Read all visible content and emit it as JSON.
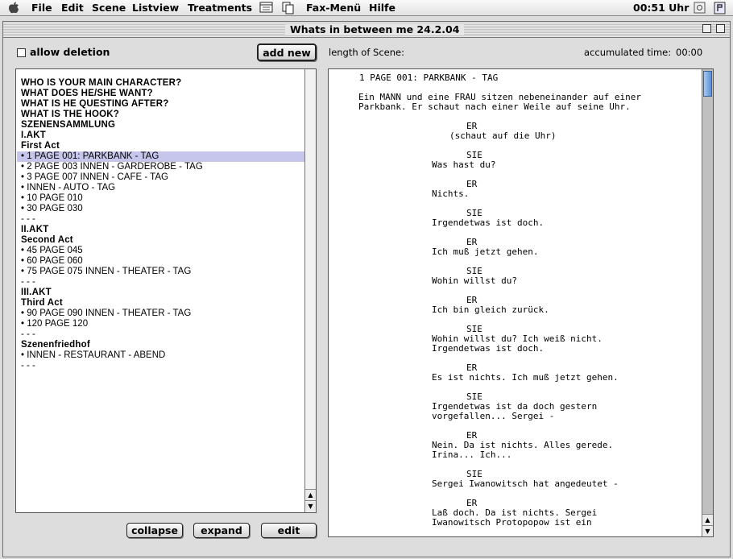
{
  "menubar": {
    "items": [
      "File",
      "Edit",
      "Scene",
      "Listview",
      "Treatments",
      "Fax-Menü",
      "Hilfe"
    ],
    "clock": "00:51 Uhr"
  },
  "window": {
    "title": "Whats in between me 24.2.04"
  },
  "controls": {
    "allow_deletion": "allow deletion",
    "add_new": "add new",
    "length_label": "length of Scene:",
    "accumulated_label": "accumulated time:",
    "accumulated_value": "00:00",
    "collapse": "collapse",
    "expand": "expand",
    "edit": "edit"
  },
  "list": [
    {
      "text": "WHO IS YOUR MAIN CHARACTER?",
      "type": "h"
    },
    {
      "text": "WHAT DOES HE/SHE WANT?",
      "type": "h"
    },
    {
      "text": "WHAT IS HE QUESTING AFTER?",
      "type": "h"
    },
    {
      "text": "WHAT IS THE HOOK?",
      "type": "h"
    },
    {
      "text": "SZENENSAMMLUNG",
      "type": "h"
    },
    {
      "text": "I.AKT",
      "type": "h"
    },
    {
      "text": " First Act",
      "type": "h"
    },
    {
      "text": " •    1  PAGE 001: PARKBANK - TAG",
      "type": "i",
      "selected": true
    },
    {
      "text": " •    2  PAGE 003 INNEN - GARDEROBE - TAG",
      "type": "i"
    },
    {
      "text": " •    3  PAGE 007 INNEN - CAFE - TAG",
      "type": "i"
    },
    {
      "text": " •  INNEN - AUTO - TAG",
      "type": "i"
    },
    {
      "text": " •  10  PAGE 010",
      "type": "i"
    },
    {
      "text": " •  30  PAGE 030",
      "type": "i"
    },
    {
      "text": "      - - -",
      "type": "i"
    },
    {
      "text": "II.AKT",
      "type": "h"
    },
    {
      "text": " Second Act",
      "type": "h"
    },
    {
      "text": " •  45  PAGE 045",
      "type": "i"
    },
    {
      "text": " •  60  PAGE 060",
      "type": "i"
    },
    {
      "text": " •  75  PAGE 075 INNEN - THEATER - TAG",
      "type": "i"
    },
    {
      "text": "      - - -",
      "type": "i"
    },
    {
      "text": "III.AKT",
      "type": "h"
    },
    {
      "text": " Third Act",
      "type": "h"
    },
    {
      "text": " •  90  PAGE 090 INNEN - THEATER - TAG",
      "type": "i"
    },
    {
      "text": " • 120  PAGE 120",
      "type": "i"
    },
    {
      "text": "      - - -",
      "type": "i"
    },
    {
      "text": " Szenenfriedhof",
      "type": "h"
    },
    {
      "text": " •  INNEN - RESTAURANT - ABEND",
      "type": "i"
    },
    {
      "text": "      - - -",
      "type": "i"
    }
  ],
  "script": [
    {
      "t": "1 PAGE 001: PARKBANK - TAG",
      "i": 1,
      "row": 0
    },
    {
      "t": "Ein MANN und eine FRAU sitzen nebeneinander auf einer",
      "i": 0,
      "row": 2
    },
    {
      "t": "Parkbank. Er schaut nach einer Weile auf seine Uhr.",
      "i": 0,
      "row": 3
    },
    {
      "t": "ER",
      "i": 3,
      "row": 5
    },
    {
      "t": "(schaut auf die Uhr)",
      "i": 2,
      "row": 6
    },
    {
      "t": "SIE",
      "i": 3,
      "row": 8
    },
    {
      "t": "Was hast du?",
      "i": 1.5,
      "row": 9
    },
    {
      "t": "ER",
      "i": 3,
      "row": 11
    },
    {
      "t": "Nichts.",
      "i": 1.5,
      "row": 12
    },
    {
      "t": "SIE",
      "i": 3,
      "row": 14
    },
    {
      "t": "Irgendetwas ist doch.",
      "i": 1.5,
      "row": 15
    },
    {
      "t": "ER",
      "i": 3,
      "row": 17
    },
    {
      "t": "Ich muß jetzt gehen.",
      "i": 1.5,
      "row": 18
    },
    {
      "t": "SIE",
      "i": 3,
      "row": 20
    },
    {
      "t": "Wohin willst du?",
      "i": 1.5,
      "row": 21
    },
    {
      "t": "ER",
      "i": 3,
      "row": 23
    },
    {
      "t": "Ich bin gleich zurück.",
      "i": 1.5,
      "row": 24
    },
    {
      "t": "SIE",
      "i": 3,
      "row": 26
    },
    {
      "t": "Wohin willst du? Ich weiß nicht.",
      "i": 1.5,
      "row": 27
    },
    {
      "t": "Irgendetwas ist doch.",
      "i": 1.5,
      "row": 28
    },
    {
      "t": "ER",
      "i": 3,
      "row": 30
    },
    {
      "t": "Es ist nichts. Ich muß jetzt gehen.",
      "i": 1.5,
      "row": 31
    },
    {
      "t": "SIE",
      "i": 3,
      "row": 33
    },
    {
      "t": "Irgendetwas ist da doch gestern",
      "i": 1.5,
      "row": 34
    },
    {
      "t": "vorgefallen... Sergei -",
      "i": 1.5,
      "row": 35
    },
    {
      "t": "ER",
      "i": 3,
      "row": 37
    },
    {
      "t": "Nein. Da ist nichts. Alles gerede.",
      "i": 1.5,
      "row": 38
    },
    {
      "t": "Irina... Ich...",
      "i": 1.5,
      "row": 39
    },
    {
      "t": "SIE",
      "i": 3,
      "row": 41
    },
    {
      "t": "Sergei Iwanowitsch hat angedeutet -",
      "i": 1.5,
      "row": 42
    },
    {
      "t": "ER",
      "i": 3,
      "row": 44
    },
    {
      "t": "Laß doch. Da ist nichts. Sergei",
      "i": 1.5,
      "row": 45
    },
    {
      "t": "Iwanowitsch Protopopow ist ein",
      "i": 1.5,
      "row": 46
    }
  ],
  "icons": {
    "apple": "apple-icon",
    "app": "application-menu-icon",
    "help": "help-icon"
  }
}
